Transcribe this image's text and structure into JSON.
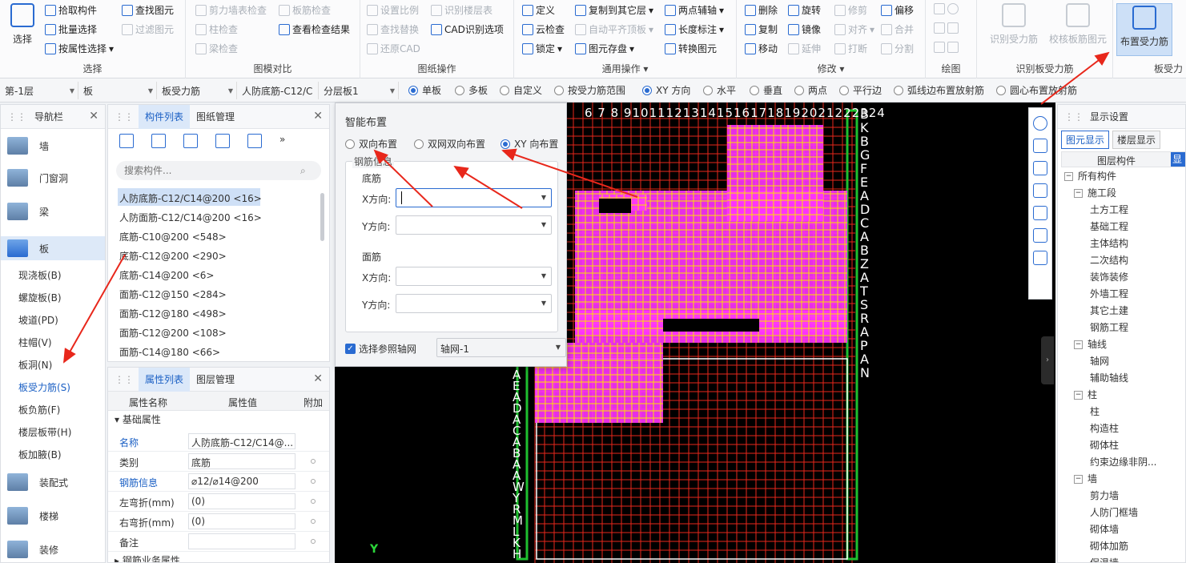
{
  "ribbon": {
    "select": {
      "title": "选择",
      "big": "选择",
      "items": [
        "拾取构件",
        "批量选择",
        "按属性选择",
        "查找图元",
        "过滤图元"
      ]
    },
    "compare": {
      "title": "图模对比",
      "items": [
        "剪力墙表检查",
        "板筋检查",
        "柱检查",
        "查看检查结果",
        "梁检查"
      ]
    },
    "drawing": {
      "title": "图纸操作",
      "items": [
        "设置比例",
        "识别楼层表",
        "查找替换",
        "CAD识别选项",
        "还原CAD"
      ]
    },
    "general": {
      "title": "通用操作",
      "items": [
        "定义",
        "复制到其它层",
        "两点辅轴",
        "云检查",
        "自动平齐顶板",
        "长度标注",
        "锁定",
        "图元存盘",
        "转换图元"
      ]
    },
    "modify": {
      "title": "修改",
      "items": [
        "删除",
        "旋转",
        "修剪",
        "偏移",
        "复制",
        "镜像",
        "对齐",
        "合并",
        "移动",
        "延伸",
        "打断",
        "分割"
      ]
    },
    "draw": {
      "title": "绘图"
    },
    "recog": {
      "title": "识别板受力筋",
      "big1": "识别受力筋",
      "big2": "校核板筋图元"
    },
    "slab": {
      "title": "板受力",
      "big": "布置受力筋"
    }
  },
  "toolbar2": {
    "floor": "第-1层",
    "type": "板",
    "subtype": "板受力筋",
    "comp": "人防底筋-C12/C",
    "layer": "分层板1",
    "radios": [
      "单板",
      "多板",
      "自定义",
      "按受力筋范围",
      "XY 方向",
      "水平",
      "垂直",
      "两点",
      "平行边",
      "弧线边布置放射筋",
      "圆心布置放射筋"
    ],
    "selected": [
      "单板",
      "XY 方向"
    ]
  },
  "nav": {
    "title": "导航栏",
    "items": [
      "墙",
      "门窗洞",
      "梁",
      "板",
      "装配式",
      "楼梯",
      "装修"
    ],
    "subitems": [
      "现浇板(B)",
      "螺旋板(B)",
      "坡道(PD)",
      "柱帽(V)",
      "板洞(N)",
      "板受力筋(S)",
      "板负筋(F)",
      "楼层板带(H)",
      "板加腋(B)"
    ],
    "active_sub": "板受力筋(S)"
  },
  "complist": {
    "tab1": "构件列表",
    "tab2": "图纸管理",
    "search_placeholder": "搜索构件...",
    "items": [
      "人防底筋-C12/C14@200 <16>",
      "人防面筋-C12/C14@200 <16>",
      "底筋-C10@200 <548>",
      "底筋-C12@200 <290>",
      "底筋-C14@200 <6>",
      "面筋-C12@150 <284>",
      "面筋-C12@180 <498>",
      "面筋-C12@200 <108>",
      "面筋-C14@180 <66>"
    ]
  },
  "props": {
    "tab1": "属性列表",
    "tab2": "图层管理",
    "cols": [
      "属性名称",
      "属性值",
      "附加"
    ],
    "group": "基础属性",
    "rows": [
      {
        "k": "名称",
        "v": "人防底筋-C12/C14@..."
      },
      {
        "k": "类别",
        "v": "底筋"
      },
      {
        "k": "钢筋信息",
        "v": "⌀12/⌀14@200"
      },
      {
        "k": "左弯折(mm)",
        "v": "(0)"
      },
      {
        "k": "右弯折(mm)",
        "v": "(0)"
      },
      {
        "k": "备注",
        "v": ""
      }
    ],
    "more": "钢筋业务属性"
  },
  "dialog": {
    "title": "智能布置",
    "opts": [
      "双向布置",
      "双网双向布置",
      "XY 向布置"
    ],
    "selected": "XY 向布置",
    "section": "钢筋信息",
    "bottom": "底筋",
    "top": "面筋",
    "xlabel": "X方向:",
    "ylabel": "Y方向:",
    "axis_check": "选择参照轴网",
    "axis_value": "轴网-1"
  },
  "canvas": {
    "top_labels": "6 7 8 9101112131415161718192021222324",
    "right_labels": [
      "B",
      "K",
      "B",
      "G",
      "F",
      "E",
      "A",
      "D",
      "C",
      "A",
      "B",
      "Z",
      "A",
      "T",
      "S",
      "R",
      "A",
      "P",
      "A",
      "N"
    ],
    "left_labels": [
      "A",
      "E",
      "A",
      "D",
      "A",
      "C",
      "A",
      "B",
      "A",
      "A",
      "W",
      "Y",
      "R",
      "M",
      "L",
      "K",
      "H"
    ],
    "y_axis": "Y"
  },
  "display": {
    "title": "显示设置",
    "tab1": "图元显示",
    "tab2": "楼层显示",
    "col1": "图层构件",
    "col2": "显示",
    "tree": [
      {
        "t": "所有构件",
        "lvl": 0,
        "box": "−"
      },
      {
        "t": "施工段",
        "lvl": 1,
        "box": "−"
      },
      {
        "t": "土方工程",
        "lvl": 2
      },
      {
        "t": "基础工程",
        "lvl": 2
      },
      {
        "t": "主体结构",
        "lvl": 2
      },
      {
        "t": "二次结构",
        "lvl": 2
      },
      {
        "t": "装饰装修",
        "lvl": 2
      },
      {
        "t": "外墙工程",
        "lvl": 2
      },
      {
        "t": "其它土建",
        "lvl": 2
      },
      {
        "t": "钢筋工程",
        "lvl": 2
      },
      {
        "t": "轴线",
        "lvl": 1,
        "box": "−"
      },
      {
        "t": "轴网",
        "lvl": 2
      },
      {
        "t": "辅助轴线",
        "lvl": 2
      },
      {
        "t": "柱",
        "lvl": 1,
        "box": "−"
      },
      {
        "t": "柱",
        "lvl": 2
      },
      {
        "t": "构造柱",
        "lvl": 2
      },
      {
        "t": "砌体柱",
        "lvl": 2
      },
      {
        "t": "约束边缘非阴...",
        "lvl": 2
      },
      {
        "t": "墙",
        "lvl": 1,
        "box": "−"
      },
      {
        "t": "剪力墙",
        "lvl": 2
      },
      {
        "t": "人防门框墙",
        "lvl": 2
      },
      {
        "t": "砌体墙",
        "lvl": 2
      },
      {
        "t": "砌体加筋",
        "lvl": 2
      },
      {
        "t": "保温墙",
        "lvl": 2
      }
    ]
  },
  "colors": {
    "accent": "#2a6bd1",
    "red": "#e8271b",
    "magenta": "#ff33ff",
    "yellow": "#ffe100",
    "green": "#1fbf2f"
  }
}
